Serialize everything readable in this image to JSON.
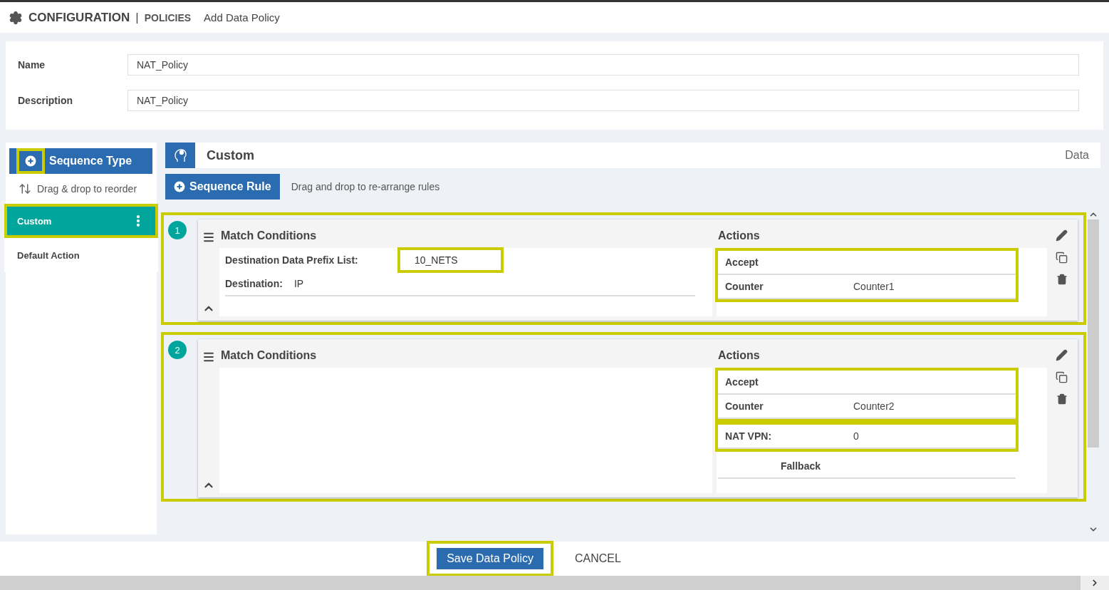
{
  "header": {
    "title": "CONFIGURATION",
    "separator": "|",
    "section": "POLICIES",
    "page": "Add Data Policy"
  },
  "form": [
    {
      "label": "Name",
      "value": "NAT_Policy"
    },
    {
      "label": "Description",
      "value": "NAT_Policy"
    }
  ],
  "sidebar": {
    "add_button": {
      "label": "Sequence Type",
      "icon_highlighted": true
    },
    "reorder_hint": "Drag & drop to reorder",
    "items": [
      {
        "label": "Custom",
        "selected": true,
        "highlighted": true
      },
      {
        "label": "Default Action",
        "selected": false,
        "highlighted": false
      }
    ]
  },
  "main": {
    "title": "Custom",
    "type_label": "Data",
    "add_rule_button": "Sequence Rule",
    "hint": "Drag and drop to re-arrange rules",
    "rules": [
      {
        "number": "1",
        "highlighted": true,
        "match_title": "Match Conditions",
        "conditions": [
          {
            "label": "Destination Data Prefix List:",
            "value": "10_NETS",
            "highlighted": true
          },
          {
            "label": "Destination:",
            "value": "IP",
            "highlighted": false
          }
        ],
        "actions_title": "Actions",
        "action_groups": [
          {
            "highlighted": true,
            "items": [
              {
                "kind": "plain",
                "label": "Accept"
              },
              {
                "kind": "pair",
                "label": "Counter",
                "value": "Counter1"
              }
            ]
          }
        ]
      },
      {
        "number": "2",
        "highlighted": true,
        "match_title": "Match Conditions",
        "actions_title": "Actions",
        "action_groups": [
          {
            "highlighted": true,
            "items": [
              {
                "kind": "plain",
                "label": "Accept"
              },
              {
                "kind": "pair",
                "label": "Counter",
                "value": "Counter2"
              }
            ]
          },
          {
            "highlighted": true,
            "items": [
              {
                "kind": "pair",
                "label": "NAT VPN:",
                "value": "0"
              }
            ]
          },
          {
            "highlighted": false,
            "items": [
              {
                "kind": "centered",
                "label": "Fallback"
              }
            ]
          }
        ]
      }
    ]
  },
  "footer": {
    "save": {
      "label": "Save Data Policy",
      "highlighted": true
    },
    "cancel": "CANCEL"
  }
}
